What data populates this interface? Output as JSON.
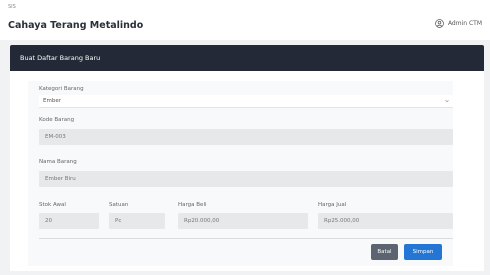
{
  "app": {
    "small_label": "SIS",
    "title": "Cahaya Terang Metalindo"
  },
  "user": {
    "name": "Admin CTM",
    "icon": "user-icon"
  },
  "card": {
    "title": "Buat Daftar Barang Baru"
  },
  "form": {
    "category": {
      "label": "Kategori Barang",
      "value": "Ember"
    },
    "code": {
      "label": "Kode Barang",
      "value": "EM-003"
    },
    "name": {
      "label": "Nama Barang",
      "value": "Ember Biru"
    },
    "stock": {
      "label": "Stok Awal",
      "value": "20"
    },
    "unit": {
      "label": "Satuan",
      "value": "Pc"
    },
    "buy_price": {
      "label": "Harga Beli",
      "value": "Rp20.000,00"
    },
    "sell_price": {
      "label": "Harga Jual",
      "value": "Rp25.000,00"
    }
  },
  "actions": {
    "cancel": "Batal",
    "save": "Simpan"
  },
  "colors": {
    "header_bg": "#232936",
    "primary": "#2476d4",
    "secondary": "#5b6470"
  }
}
